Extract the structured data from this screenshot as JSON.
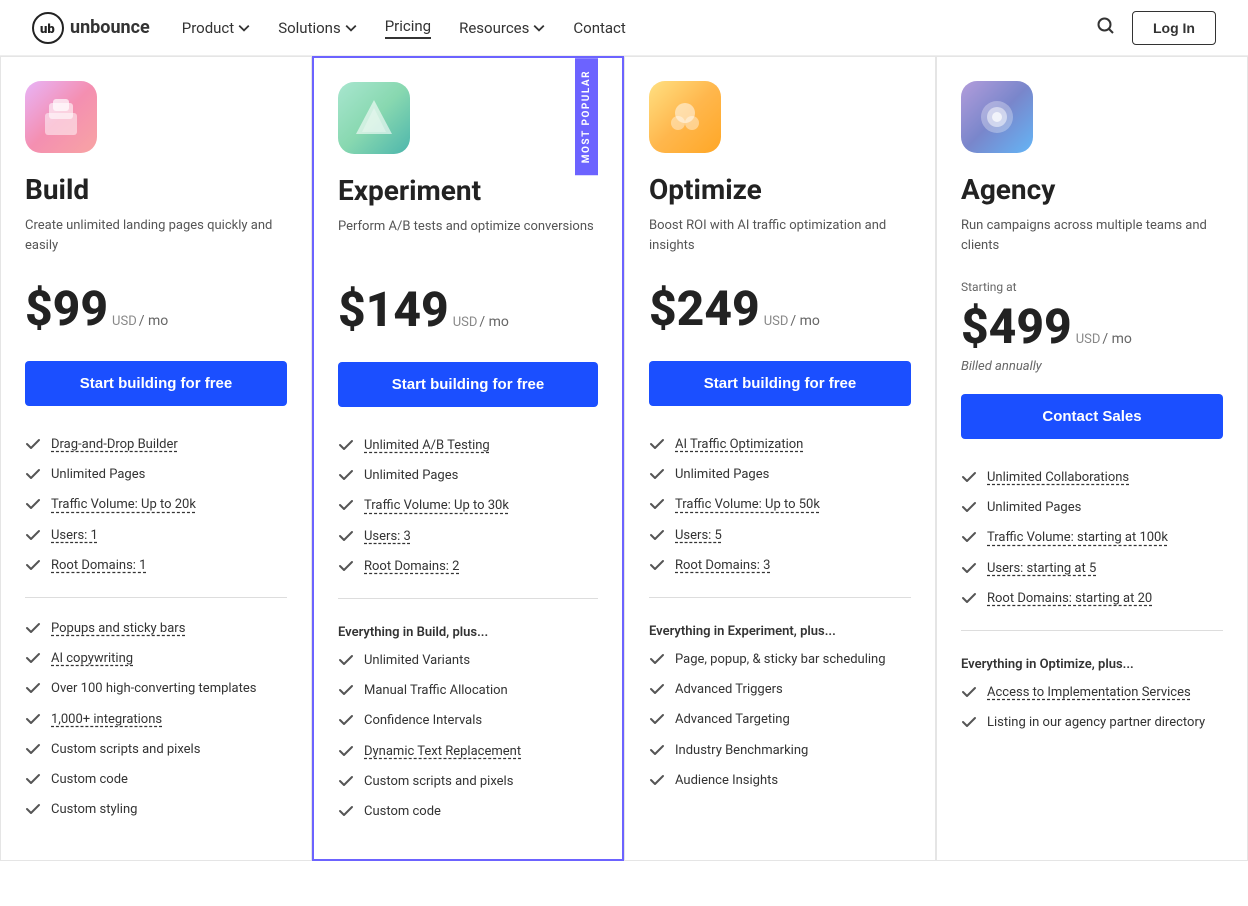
{
  "nav": {
    "logo_text": "unbounce",
    "links": [
      {
        "label": "Product",
        "has_arrow": true,
        "active": false
      },
      {
        "label": "Solutions",
        "has_arrow": true,
        "active": false
      },
      {
        "label": "Pricing",
        "has_arrow": false,
        "active": true
      },
      {
        "label": "Resources",
        "has_arrow": true,
        "active": false
      },
      {
        "label": "Contact",
        "has_arrow": false,
        "active": false
      }
    ],
    "login_label": "Log In"
  },
  "plans": [
    {
      "id": "build",
      "name": "Build",
      "icon_class": "build",
      "icon_emoji": "🗂",
      "desc": "Create unlimited landing pages quickly and easily",
      "starting_at": "",
      "price": "$99",
      "price_num": "99",
      "currency": "$",
      "usd": "USD",
      "period": "/ mo",
      "billed": "",
      "cta_label": "Start building for free",
      "cta_style": "primary",
      "featured": false,
      "features_basic": [
        {
          "label": "Drag-and-Drop Builder",
          "underlined": true
        },
        {
          "label": "Unlimited Pages",
          "underlined": false
        },
        {
          "label": "Traffic Volume: Up to 20k",
          "underlined": true
        },
        {
          "label": "Users: 1",
          "underlined": true
        },
        {
          "label": "Root Domains: 1",
          "underlined": true
        }
      ],
      "everything_plus": "",
      "features_extra": [
        {
          "label": "Popups and sticky bars",
          "underlined": true
        },
        {
          "label": "AI copywriting",
          "underlined": true
        },
        {
          "label": "Over 100 high-converting templates",
          "underlined": false
        },
        {
          "label": "1,000+ integrations",
          "underlined": true
        },
        {
          "label": "Custom scripts and pixels",
          "underlined": false
        },
        {
          "label": "Custom code",
          "underlined": false
        },
        {
          "label": "Custom styling",
          "underlined": false
        }
      ]
    },
    {
      "id": "experiment",
      "name": "Experiment",
      "icon_class": "experiment",
      "icon_emoji": "🔺",
      "desc": "Perform A/B tests and optimize conversions",
      "starting_at": "",
      "price": "$149",
      "price_num": "149",
      "currency": "$",
      "usd": "USD",
      "period": "/ mo",
      "billed": "",
      "cta_label": "Start building for free",
      "cta_style": "primary",
      "featured": true,
      "features_basic": [
        {
          "label": "Unlimited A/B Testing",
          "underlined": true
        },
        {
          "label": "Unlimited Pages",
          "underlined": false
        },
        {
          "label": "Traffic Volume: Up to 30k",
          "underlined": true
        },
        {
          "label": "Users: 3",
          "underlined": true
        },
        {
          "label": "Root Domains: 2",
          "underlined": true
        }
      ],
      "everything_plus": "Everything in Build, plus...",
      "features_extra": [
        {
          "label": "Unlimited Variants",
          "underlined": false
        },
        {
          "label": "Manual Traffic Allocation",
          "underlined": false
        },
        {
          "label": "Confidence Intervals",
          "underlined": false
        },
        {
          "label": "Dynamic Text Replacement",
          "underlined": true
        },
        {
          "label": "Custom scripts and pixels",
          "underlined": false
        },
        {
          "label": "Custom code",
          "underlined": false
        }
      ]
    },
    {
      "id": "optimize",
      "name": "Optimize",
      "icon_class": "optimize",
      "icon_emoji": "🐙",
      "desc": "Boost ROI with AI traffic optimization and insights",
      "starting_at": "",
      "price": "$249",
      "price_num": "249",
      "currency": "$",
      "usd": "USD",
      "period": "/ mo",
      "billed": "",
      "cta_label": "Start building for free",
      "cta_style": "primary",
      "featured": false,
      "features_basic": [
        {
          "label": "AI Traffic Optimization",
          "underlined": true
        },
        {
          "label": "Unlimited Pages",
          "underlined": false
        },
        {
          "label": "Traffic Volume: Up to 50k",
          "underlined": true
        },
        {
          "label": "Users: 5",
          "underlined": true
        },
        {
          "label": "Root Domains: 3",
          "underlined": true
        }
      ],
      "everything_plus": "Everything in Experiment, plus...",
      "features_extra": [
        {
          "label": "Page, popup, & sticky bar scheduling",
          "underlined": false
        },
        {
          "label": "Advanced Triggers",
          "underlined": false
        },
        {
          "label": "Advanced Targeting",
          "underlined": false
        },
        {
          "label": "Industry Benchmarking",
          "underlined": false
        },
        {
          "label": "Audience Insights",
          "underlined": false
        }
      ]
    },
    {
      "id": "agency",
      "name": "Agency",
      "icon_class": "agency",
      "icon_emoji": "🔮",
      "desc": "Run campaigns across multiple teams and clients",
      "starting_at": "Starting at",
      "price": "$499",
      "price_num": "499",
      "currency": "$",
      "usd": "USD",
      "period": "/ mo",
      "billed": "Billed annually",
      "cta_label": "Contact Sales",
      "cta_style": "secondary",
      "featured": false,
      "features_basic": [
        {
          "label": "Unlimited Collaborations",
          "underlined": true
        },
        {
          "label": "Unlimited Pages",
          "underlined": false
        },
        {
          "label": "Traffic Volume: starting at 100k",
          "underlined": true
        },
        {
          "label": "Users: starting at 5",
          "underlined": true
        },
        {
          "label": "Root Domains: starting at 20",
          "underlined": true
        }
      ],
      "everything_plus": "Everything in Optimize, plus...",
      "features_extra": [
        {
          "label": "Access to Implementation Services",
          "underlined": true
        },
        {
          "label": "Listing in our agency partner directory",
          "underlined": false
        }
      ]
    }
  ],
  "most_popular": "MOST POPULAR"
}
